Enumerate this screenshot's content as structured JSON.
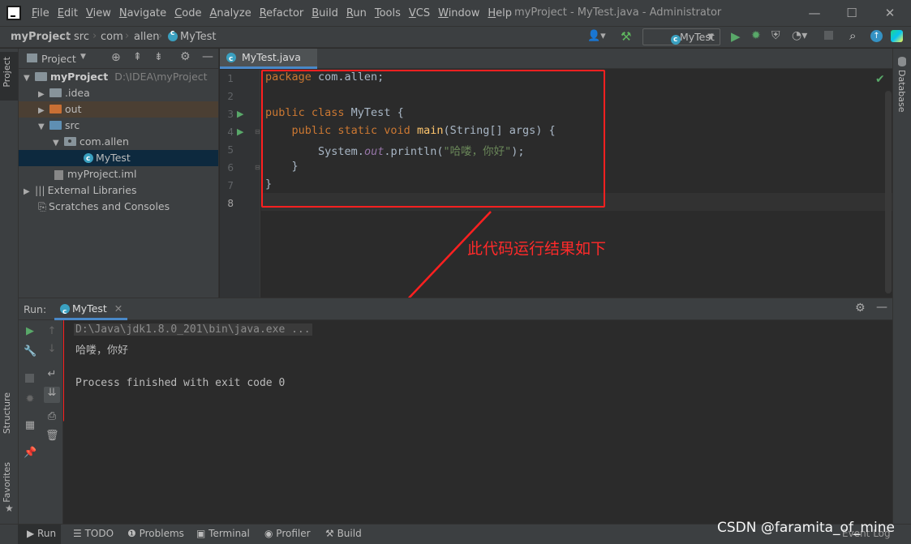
{
  "menu": [
    "File",
    "Edit",
    "View",
    "Navigate",
    "Code",
    "Analyze",
    "Refactor",
    "Build",
    "Run",
    "Tools",
    "VCS",
    "Window",
    "Help"
  ],
  "window_title": "myProject - MyTest.java - Administrator",
  "breadcrumbs": [
    "myProject",
    "src",
    "com",
    "allen",
    "MyTest"
  ],
  "run_config": "MyTest",
  "left_stripe": {
    "project": "Project",
    "structure": "Structure",
    "favorites": "Favorites"
  },
  "right_stripe": {
    "database": "Database"
  },
  "project_panel": {
    "title": "Project",
    "root": "myProject",
    "root_path": "D:\\IDEA\\myProject",
    "items": [
      ".idea",
      "out",
      "src",
      "com.allen",
      "MyTest",
      "myProject.iml",
      "External Libraries",
      "Scratches and Consoles"
    ]
  },
  "editor": {
    "tab": "MyTest.java",
    "line_numbers": [
      "1",
      "2",
      "3",
      "4",
      "5",
      "6",
      "7",
      "8"
    ],
    "code": {
      "l1_kw": "package",
      "l1_rest": " com.allen;",
      "l3_kw": "public class",
      "l3_rest": " MyTest {",
      "l4_kw": "public static void",
      "l4_fn": "main",
      "l4_rest": "(String[] args) {",
      "l5_a": "System.",
      "l5_out": "out",
      "l5_b": ".println(",
      "l5_str": "\"哈喽，你好\"",
      "l5_c": ");",
      "l6": "}",
      "l7": "}"
    }
  },
  "annotation": "此代码运行结果如下",
  "run_panel": {
    "label": "Run:",
    "tab": "MyTest",
    "console": {
      "cmd": "D:\\Java\\jdk1.8.0_201\\bin\\java.exe ...",
      "output": "哈喽，你好",
      "exit": "Process finished with exit code 0"
    }
  },
  "bottom_tabs": [
    "Run",
    "TODO",
    "Problems",
    "Terminal",
    "Profiler",
    "Build"
  ],
  "event_log": "Event Log",
  "watermark": "CSDN @faramita_of_mine",
  "colors": {
    "annotation_red": "#ff2020",
    "keyword": "#cc7832",
    "string": "#6a8759",
    "function": "#ffc66d"
  }
}
